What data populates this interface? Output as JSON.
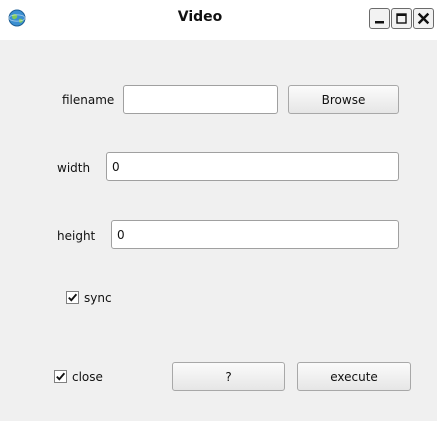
{
  "window": {
    "title": "Video",
    "icon": "globe-icon",
    "controls": [
      "minimize-icon",
      "maximize-icon",
      "close-icon"
    ]
  },
  "form": {
    "filename": {
      "label": "filename",
      "value": ""
    },
    "browse_label": "Browse",
    "width": {
      "label": "width",
      "value": "0"
    },
    "height": {
      "label": "height",
      "value": "0"
    },
    "sync": {
      "label": "sync",
      "checked": true
    },
    "close": {
      "label": "close",
      "checked": true
    },
    "help_label": "?",
    "execute_label": "execute"
  }
}
